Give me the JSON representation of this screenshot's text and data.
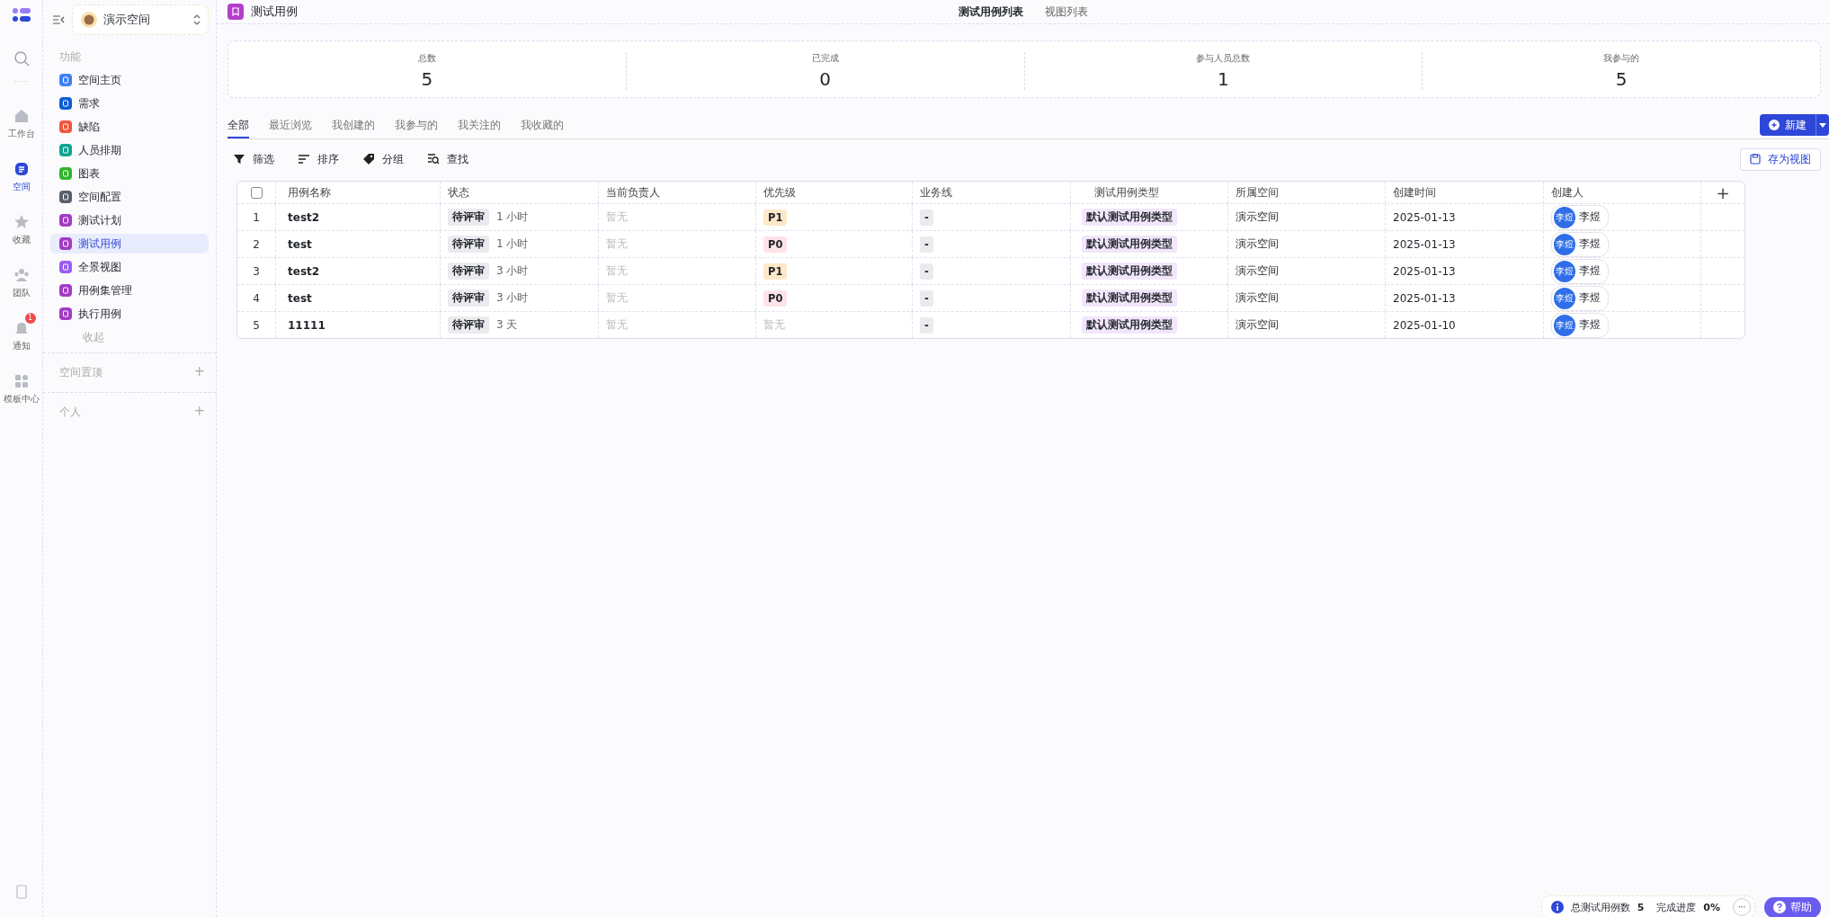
{
  "rail": {
    "items": [
      {
        "label": "工作台",
        "kind": "home",
        "selected": false
      },
      {
        "label": "空间",
        "kind": "space",
        "selected": true
      },
      {
        "label": "收藏",
        "kind": "star",
        "selected": false
      },
      {
        "label": "团队",
        "kind": "team",
        "selected": false
      },
      {
        "label": "通知",
        "kind": "bell",
        "selected": false,
        "badge": "1"
      },
      {
        "label": "模板中心",
        "kind": "grid",
        "selected": false
      }
    ]
  },
  "sidebar": {
    "space": "演示空间",
    "section": "功能",
    "items": [
      {
        "label": "空间主页",
        "color": "#3f7ff5",
        "selected": false
      },
      {
        "label": "需求",
        "color": "#0a5fd6",
        "selected": false
      },
      {
        "label": "缺陷",
        "color": "#f0563a",
        "selected": false
      },
      {
        "label": "人员排期",
        "color": "#12a594",
        "selected": false
      },
      {
        "label": "图表",
        "color": "#2fb62c",
        "selected": false
      },
      {
        "label": "空间配置",
        "color": "#5a5f6b",
        "selected": false
      },
      {
        "label": "测试计划",
        "color": "#a33bc4",
        "selected": false
      },
      {
        "label": "测试用例",
        "color": "#a33bc4",
        "selected": true
      },
      {
        "label": "全景视图",
        "color": "#9b5cf0",
        "selected": false
      },
      {
        "label": "用例集管理",
        "color": "#a33bc4",
        "selected": false
      },
      {
        "label": "执行用例",
        "color": "#a33bc4",
        "selected": false
      }
    ],
    "collapse": "收起",
    "groups": [
      {
        "label": "空间置顶",
        "add": "+"
      },
      {
        "label": "个人",
        "add": "+"
      }
    ]
  },
  "header": {
    "title": "测试用例",
    "tabs": [
      {
        "label": "测试用例列表",
        "selected": true
      },
      {
        "label": "视图列表",
        "selected": false
      }
    ]
  },
  "stats": [
    {
      "label": "总数",
      "value": "5"
    },
    {
      "label": "已完成",
      "value": "0"
    },
    {
      "label": "参与人员总数",
      "value": "1"
    },
    {
      "label": "我参与的",
      "value": "5"
    }
  ],
  "filter_tabs": [
    {
      "label": "全部",
      "selected": true
    },
    {
      "label": "最近浏览",
      "selected": false
    },
    {
      "label": "我创建的",
      "selected": false
    },
    {
      "label": "我参与的",
      "selected": false
    },
    {
      "label": "我关注的",
      "selected": false
    },
    {
      "label": "我收藏的",
      "selected": false
    }
  ],
  "new_button": "新建",
  "toolbar": [
    {
      "label": "筛选",
      "kind": "filter"
    },
    {
      "label": "排序",
      "kind": "sort"
    },
    {
      "label": "分组",
      "kind": "group"
    },
    {
      "label": "查找",
      "kind": "find"
    }
  ],
  "save_view": "存为视图",
  "table": {
    "select_all": {
      "checked": false
    },
    "columns": [
      "用例名称",
      "状态",
      "当前负责人",
      "优先级",
      "业务线",
      "测试用例类型",
      "所属空间",
      "创建时间",
      "创建人"
    ],
    "add_column": "+",
    "rows": [
      {
        "index": "1",
        "name": "test2",
        "status": "待评审",
        "age": "1 小时",
        "owner": "暂无",
        "priority": "P1",
        "biz": "-",
        "type": "默认测试用例类型",
        "space": "演示空间",
        "created": "2025-01-13",
        "creator": "李煜",
        "avatar": "李煜"
      },
      {
        "index": "2",
        "name": "test",
        "status": "待评审",
        "age": "1 小时",
        "owner": "暂无",
        "priority": "P0",
        "biz": "-",
        "type": "默认测试用例类型",
        "space": "演示空间",
        "created": "2025-01-13",
        "creator": "李煜",
        "avatar": "李煜"
      },
      {
        "index": "3",
        "name": "test2",
        "status": "待评审",
        "age": "3 小时",
        "owner": "暂无",
        "priority": "P1",
        "biz": "-",
        "type": "默认测试用例类型",
        "space": "演示空间",
        "created": "2025-01-13",
        "creator": "李煜",
        "avatar": "李煜"
      },
      {
        "index": "4",
        "name": "test",
        "status": "待评审",
        "age": "3 小时",
        "owner": "暂无",
        "priority": "P0",
        "biz": "-",
        "type": "默认测试用例类型",
        "space": "演示空间",
        "created": "2025-01-13",
        "creator": "李煜",
        "avatar": "李煜"
      },
      {
        "index": "5",
        "name": "11111",
        "status": "待评审",
        "age": "3 天",
        "owner": "暂无",
        "priority": "暂无",
        "biz": "-",
        "type": "默认测试用例类型",
        "space": "演示空间",
        "created": "2025-01-10",
        "creator": "李煜",
        "avatar": "李煜"
      }
    ]
  },
  "footer": {
    "info": "总测试用例数",
    "count": "5",
    "progress_label": "完成进度",
    "progress": "0%",
    "more": "···",
    "help": "帮助"
  }
}
